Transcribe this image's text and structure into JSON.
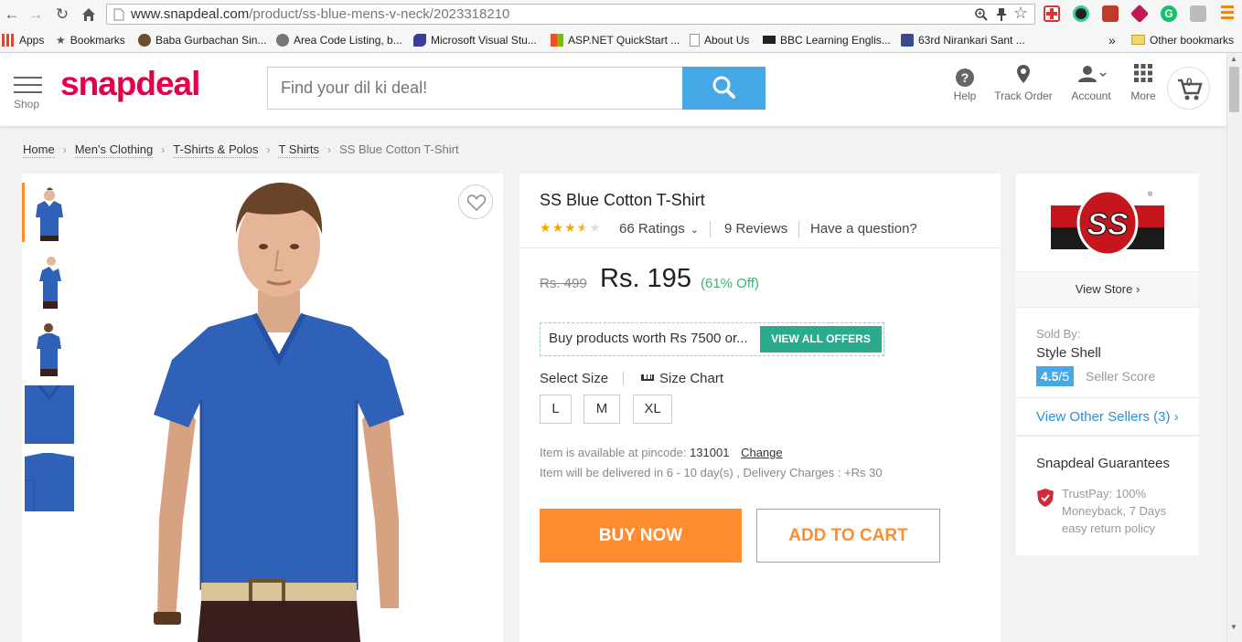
{
  "browser": {
    "url_host": "www.snapdeal.com",
    "url_path": "/product/ss-blue-mens-v-neck/2023318210",
    "bookmarks": [
      {
        "label": "Apps",
        "icon": "apps-grid-icon",
        "color": "#e0452f"
      },
      {
        "label": "Bookmarks",
        "icon": "star-icon",
        "color": "#555555"
      },
      {
        "label": "Baba Gurbachan Sin...",
        "icon": "portrait-icon",
        "color": "#6b4c2e"
      },
      {
        "label": "Area Code Listing, b...",
        "icon": "portrait-icon",
        "color": "#777777"
      },
      {
        "label": "Microsoft Visual Stu...",
        "icon": "visual-studio-icon",
        "color": "#3b3b9e"
      },
      {
        "label": "ASP.NET QuickStart ...",
        "icon": "windows-logo-icon",
        "color": "#f25022"
      },
      {
        "label": "About Us",
        "icon": "page-icon",
        "color": "#cccccc"
      },
      {
        "label": "BBC Learning Englis...",
        "icon": "bbc-icon",
        "color": "#222222"
      },
      {
        "label": "63rd Nirankari Sant ...",
        "icon": "portrait-icon",
        "color": "#3a4a8a"
      }
    ],
    "overflow_label": "»",
    "other_bookmarks": "Other bookmarks"
  },
  "header": {
    "shop_label": "Shop",
    "logo_text": "snapdeal",
    "search_placeholder": "Find your dil ki deal!",
    "help_label": "Help",
    "track_order_label": "Track Order",
    "account_label": "Account",
    "more_label": "More",
    "cart_count": "0",
    "brand_color": "#e40046",
    "search_button_color": "#46a8e5"
  },
  "breadcrumb": {
    "items": [
      "Home",
      "Men's Clothing",
      "T-Shirts & Polos",
      "T Shirts"
    ],
    "current": "SS Blue Cotton T-Shirt"
  },
  "gallery": {
    "thumbnail_count": 5,
    "selected_index": 0,
    "shirt_color": "#2f61b9"
  },
  "product": {
    "title": "SS Blue Cotton T-Shirt",
    "rating_stars": 3.5,
    "ratings_label": "66 Ratings",
    "reviews_label": "9 Reviews",
    "question_label": "Have a question?",
    "mrp": "Rs. 499",
    "price": "Rs. 195",
    "discount": "(61% Off)",
    "offer_text": "Buy products worth Rs 7500 or...",
    "offer_button": "VIEW ALL OFFERS",
    "select_size_label": "Select Size",
    "size_chart_label": "Size Chart",
    "sizes": [
      "L",
      "M",
      "XL"
    ],
    "pincode_prefix": "Item is available at pincode:",
    "pincode": "131001",
    "change_label": "Change",
    "delivery_text": "Item will be delivered in 6 - 10 day(s) , Delivery Charges : +Rs 30",
    "buy_now": "BUY NOW",
    "add_to_cart": "ADD TO CART",
    "accent_color": "#ff8c2e",
    "discount_color": "#3cb371"
  },
  "seller": {
    "brand_logo_text": "SS",
    "view_store": "View Store",
    "sold_by_label": "Sold By:",
    "seller_name": "Style Shell",
    "score_value": "4.5",
    "score_max": "/5",
    "score_label": "Seller Score",
    "other_sellers": "View Other Sellers (3)",
    "guarantees_title": "Snapdeal Guarantees",
    "guarantee_text": "TrustPay: 100% Moneyback, 7 Days easy return policy"
  }
}
